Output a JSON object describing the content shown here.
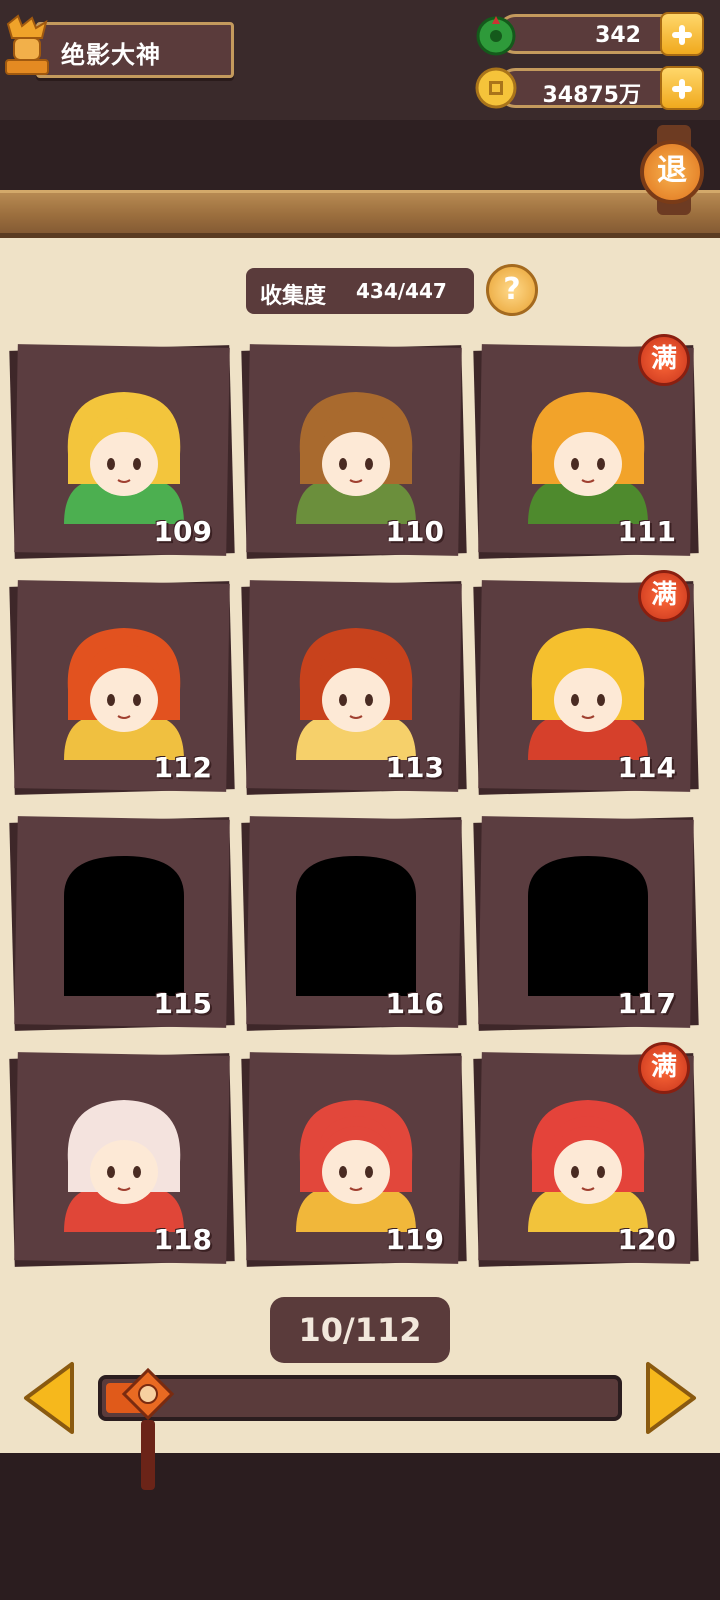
{
  "player": {
    "name": "绝影大神"
  },
  "currency": {
    "gems": "342",
    "coins": "34875万"
  },
  "exit_label": "退",
  "collection": {
    "label": "收集度",
    "value": "434/447",
    "help": "?"
  },
  "cards": [
    {
      "number": "109",
      "full": false,
      "locked": false,
      "hair": "#f3c53c",
      "accent": "#4caf50"
    },
    {
      "number": "110",
      "full": false,
      "locked": false,
      "hair": "#a96a2e",
      "accent": "#6b8f3c"
    },
    {
      "number": "111",
      "full": true,
      "locked": false,
      "hair": "#f2a32a",
      "accent": "#4e8a2d"
    },
    {
      "number": "112",
      "full": false,
      "locked": false,
      "hair": "#e2521f",
      "accent": "#f0c040"
    },
    {
      "number": "113",
      "full": false,
      "locked": false,
      "hair": "#c8421c",
      "accent": "#f6d06a"
    },
    {
      "number": "114",
      "full": true,
      "locked": false,
      "hair": "#f5c02e",
      "accent": "#d6402b"
    },
    {
      "number": "115",
      "full": false,
      "locked": true,
      "hair": "#000000",
      "accent": "#000000"
    },
    {
      "number": "116",
      "full": false,
      "locked": true,
      "hair": "#000000",
      "accent": "#000000"
    },
    {
      "number": "117",
      "full": false,
      "locked": true,
      "hair": "#000000",
      "accent": "#000000"
    },
    {
      "number": "118",
      "full": false,
      "locked": false,
      "hair": "#f4e3de",
      "accent": "#e04638"
    },
    {
      "number": "119",
      "full": false,
      "locked": false,
      "hair": "#e2473b",
      "accent": "#f1b73a"
    },
    {
      "number": "120",
      "full": true,
      "locked": false,
      "hair": "#e4433a",
      "accent": "#f2c33b"
    }
  ],
  "full_badge_label": "满",
  "pager": {
    "label": "10/112",
    "progress": 0.09
  }
}
